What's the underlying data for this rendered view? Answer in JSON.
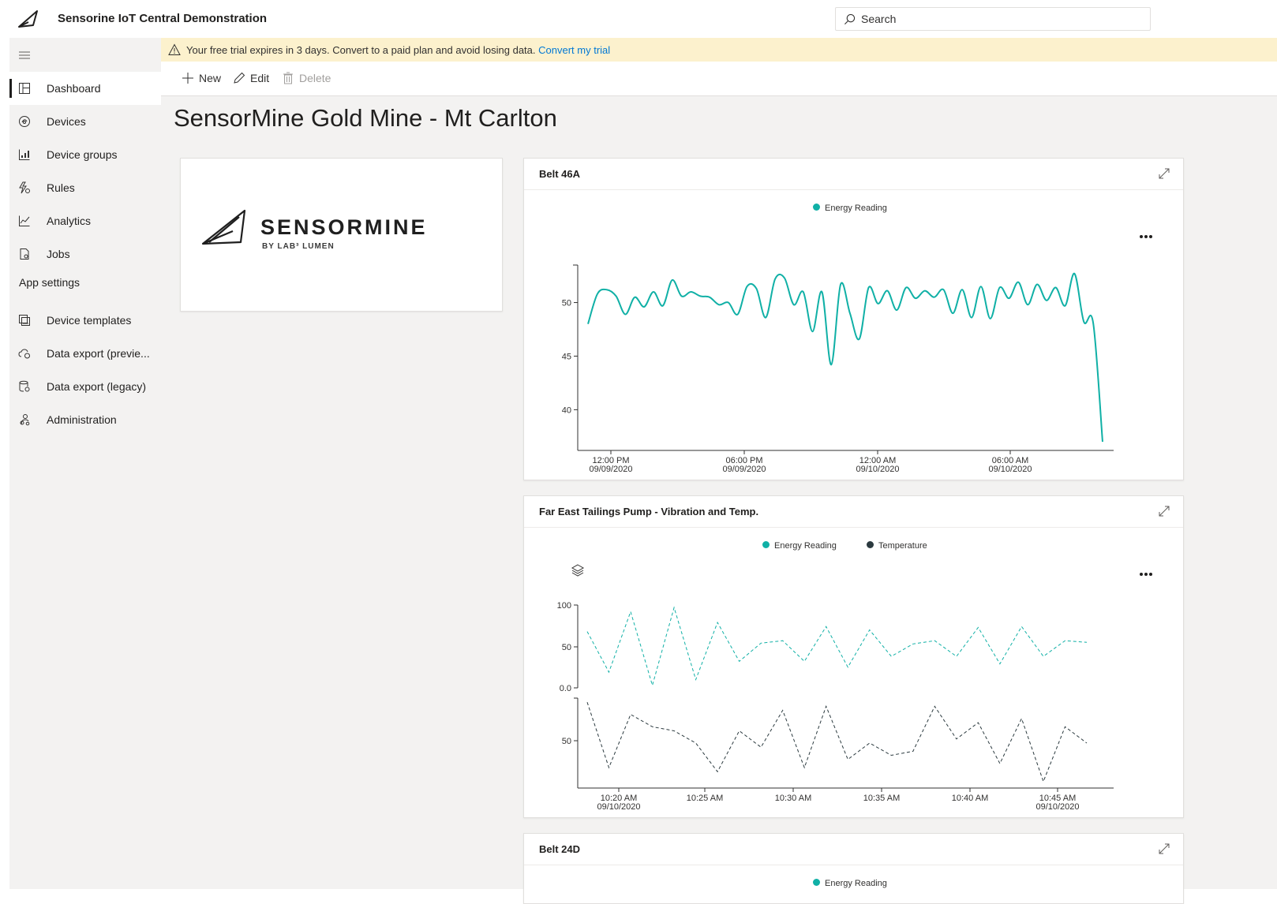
{
  "app": {
    "title": "Sensorine IoT Central Demonstration"
  },
  "search": {
    "placeholder": "Search"
  },
  "sidebar": {
    "items": [
      {
        "label": "Dashboard",
        "icon": "dashboard-icon",
        "active": true
      },
      {
        "label": "Devices",
        "icon": "devices-icon"
      },
      {
        "label": "Device groups",
        "icon": "device-groups-icon"
      },
      {
        "label": "Rules",
        "icon": "rules-icon"
      },
      {
        "label": "Analytics",
        "icon": "analytics-icon"
      },
      {
        "label": "Jobs",
        "icon": "jobs-icon"
      }
    ],
    "section_label": "App settings",
    "settings_items": [
      {
        "label": "Device templates",
        "icon": "device-templates-icon"
      },
      {
        "label": "Data export (previe...",
        "icon": "data-export-preview-icon"
      },
      {
        "label": "Data export (legacy)",
        "icon": "data-export-legacy-icon"
      },
      {
        "label": "Administration",
        "icon": "administration-icon"
      }
    ]
  },
  "banner": {
    "text": "Your free trial expires in 3 days. Convert to a paid plan and avoid losing data.",
    "link": "Convert my trial"
  },
  "toolbar": {
    "new_label": "New",
    "edit_label": "Edit",
    "delete_label": "Delete"
  },
  "page": {
    "title": "SensorMine Gold Mine - Mt Carlton"
  },
  "logo_tile": {
    "brand": "SENSORMINE",
    "tagline": "BY LAB³ LUMEN"
  },
  "colors": {
    "teal": "#10b0a6",
    "dark": "#2b3a3f",
    "accent": "#0078d4",
    "banner_bg": "#fcf1cd"
  },
  "tiles": {
    "belt46a": {
      "title": "Belt 46A",
      "legend": [
        "Energy Reading"
      ]
    },
    "pump": {
      "title": "Far East Tailings Pump - Vibration and Temp.",
      "legend": [
        "Energy Reading",
        "Temperature"
      ]
    },
    "belt24d": {
      "title": "Belt 24D",
      "legend": [
        "Energy Reading"
      ]
    }
  },
  "chart_data": [
    {
      "id": "belt46a",
      "type": "line",
      "series": [
        {
          "name": "Energy Reading",
          "color": "#10b0a6",
          "style": "solid",
          "values": [
            48.0,
            50.8,
            51.2,
            50.6,
            48.9,
            50.5,
            49.6,
            51.0,
            49.7,
            52.1,
            50.6,
            51.0,
            50.6,
            50.5,
            49.8,
            50.0,
            48.9,
            51.5,
            51.3,
            48.6,
            52.2,
            52.3,
            49.8,
            51.0,
            47.3,
            51.0,
            44.2,
            51.7,
            49.0,
            46.6,
            51.4,
            49.9,
            51.1,
            49.3,
            51.4,
            50.4,
            51.1,
            50.5,
            51.2,
            49.0,
            51.2,
            48.6,
            51.5,
            48.5,
            51.4,
            50.4,
            51.9,
            49.8,
            51.7,
            50.2,
            51.4,
            49.7,
            52.7,
            48.2,
            48.1,
            37.0
          ]
        }
      ],
      "x_ticks": [
        {
          "time": "12:00 PM",
          "date": "09/09/2020"
        },
        {
          "time": "06:00 PM",
          "date": "09/09/2020"
        },
        {
          "time": "12:00 AM",
          "date": "09/10/2020"
        },
        {
          "time": "06:00 AM",
          "date": "09/10/2020"
        }
      ],
      "y_ticks": [
        50,
        45,
        40
      ],
      "ylim": [
        36.2,
        53.5
      ],
      "grid": false,
      "legend_position": "top-center"
    },
    {
      "id": "pump",
      "type": "line",
      "panels": [
        {
          "series_name": "Energy Reading",
          "color": "#10b0a6",
          "style": "dashed",
          "values": [
            68,
            19,
            92,
            3,
            97,
            10,
            79,
            32,
            54,
            57,
            32,
            74,
            25,
            70,
            38,
            53,
            57,
            38,
            73,
            29,
            74,
            38,
            57,
            55
          ],
          "y_ticks": [
            "100",
            "50",
            "0.0"
          ],
          "ylim": [
            0,
            100
          ]
        },
        {
          "series_name": "Temperature",
          "color": "#2b3a3f",
          "style": "dashed",
          "values": [
            105,
            25,
            90,
            75,
            70,
            55,
            20,
            70,
            50,
            95,
            25,
            100,
            35,
            55,
            40,
            45,
            100,
            60,
            80,
            30,
            85,
            8,
            75,
            55
          ],
          "y_ticks": [
            "50"
          ],
          "ylim": [
            0,
            110
          ]
        }
      ],
      "x_ticks": [
        {
          "time": "10:20 AM",
          "date": "09/10/2020"
        },
        {
          "time": "10:25 AM",
          "date": ""
        },
        {
          "time": "10:30 AM",
          "date": ""
        },
        {
          "time": "10:35 AM",
          "date": ""
        },
        {
          "time": "10:40 AM",
          "date": ""
        },
        {
          "time": "10:45 AM",
          "date": "09/10/2020"
        }
      ],
      "grid": false,
      "legend_position": "top-center"
    }
  ]
}
